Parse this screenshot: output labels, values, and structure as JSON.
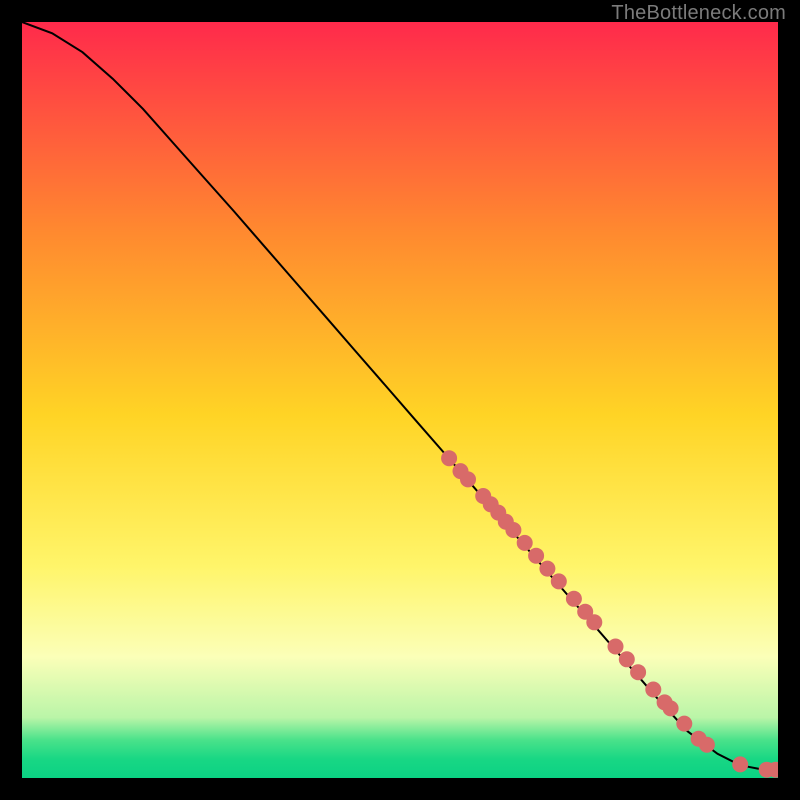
{
  "attribution": "TheBottleneck.com",
  "colors": {
    "background": "#000000",
    "attribution_text": "#7b7b7b",
    "gradient_top": "#ff2a4b",
    "gradient_mid_upper": "#ff8a2f",
    "gradient_mid": "#ffd425",
    "gradient_mid_lower": "#fff56a",
    "gradient_lower": "#fbffb8",
    "gradient_green1": "#baf5a8",
    "gradient_green2": "#49e28a",
    "gradient_green3": "#18d784",
    "gradient_bottom": "#0bd183",
    "curve": "#000000",
    "marker": "#d86a69"
  },
  "chart_data": {
    "type": "line",
    "title": "",
    "xlabel": "",
    "ylabel": "",
    "xlim": [
      0,
      100
    ],
    "ylim": [
      0,
      100
    ],
    "legend": false,
    "grid": false,
    "series": [
      {
        "name": "curve",
        "kind": "line",
        "x": [
          0,
          4,
          8,
          12,
          16,
          20,
          24,
          28,
          32,
          36,
          40,
          44,
          48,
          52,
          56,
          60,
          64,
          68,
          72,
          76,
          80,
          84,
          88,
          92,
          94,
          96,
          97.5,
          99,
          100
        ],
        "y": [
          100,
          98.5,
          96,
          92.5,
          88.5,
          84,
          79.5,
          75,
          70.4,
          65.8,
          61.2,
          56.6,
          52,
          47.4,
          42.8,
          38.2,
          33.6,
          29,
          24.4,
          19.8,
          15.2,
          10.6,
          6.2,
          3.2,
          2.2,
          1.5,
          1.2,
          1.1,
          1.1
        ]
      },
      {
        "name": "markers",
        "kind": "scatter",
        "x": [
          56.5,
          58,
          59,
          61,
          62,
          63,
          64,
          65,
          66.5,
          68,
          69.5,
          71,
          73,
          74.5,
          75.7,
          78.5,
          80,
          81.5,
          83.5,
          85,
          85.8,
          87.6,
          89.5,
          90.6,
          95,
          98.5,
          99.7
        ],
        "y": [
          42.3,
          40.6,
          39.5,
          37.3,
          36.2,
          35.1,
          33.9,
          32.8,
          31.1,
          29.4,
          27.7,
          26,
          23.7,
          22,
          20.6,
          17.4,
          15.7,
          14,
          11.7,
          10,
          9.2,
          7.2,
          5.2,
          4.4,
          1.8,
          1.1,
          1.1
        ]
      }
    ]
  }
}
